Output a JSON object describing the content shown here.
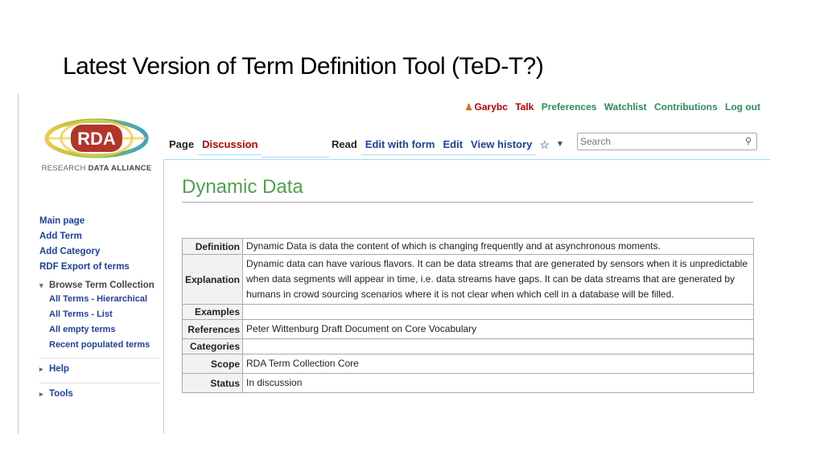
{
  "slide": {
    "title": "Latest Version of Term Definition Tool (TeD-T?)"
  },
  "personal": {
    "user": "Garybc",
    "talk": "Talk",
    "preferences": "Preferences",
    "watchlist": "Watchlist",
    "contributions": "Contributions",
    "logout": "Log out"
  },
  "logo": {
    "mark": "RDA",
    "tagline_light": "RESEARCH ",
    "tagline_bold": "DATA ALLIANCE"
  },
  "sidebar": {
    "items": [
      "Main page",
      "Add Term",
      "Add Category",
      "RDF Export of terms"
    ],
    "browse": {
      "label": "Browse Term Collection",
      "items": [
        "All Terms - Hierarchical",
        "All Terms - List",
        "All empty terms",
        "Recent populated terms"
      ]
    },
    "help": "Help",
    "tools": "Tools"
  },
  "tabs": {
    "page": "Page",
    "discussion": "Discussion",
    "read": "Read",
    "edit_form": "Edit with form",
    "edit": "Edit",
    "history": "View history"
  },
  "search": {
    "placeholder": "Search"
  },
  "page": {
    "title": "Dynamic Data"
  },
  "term": {
    "rows": [
      {
        "label": "Definition",
        "value": "Dynamic Data is data the content of which is changing frequently and at asynchronous moments."
      },
      {
        "label": "Explanation",
        "value": "Dynamic data can have various flavors. It can be data streams that are generated by sensors when it is unpredictable when data segments will appear in time, i.e. data streams have gaps. It can be data streams that are generated by humans in crowd sourcing scenarios where it is not clear when which cell in a database will be filled."
      },
      {
        "label": "Examples",
        "value": ""
      },
      {
        "label": "References",
        "value": "Peter Wittenburg Draft Document on Core Vocabulary"
      },
      {
        "label": "Categories",
        "value": ""
      },
      {
        "label": "Scope",
        "value": "RDA Term Collection Core"
      },
      {
        "label": "Status",
        "value": "In discussion"
      }
    ]
  }
}
